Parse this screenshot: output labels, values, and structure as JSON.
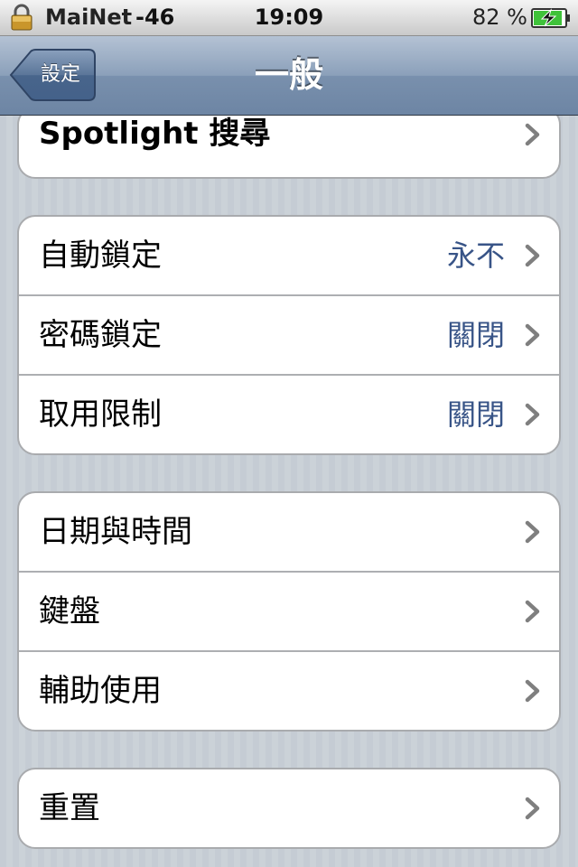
{
  "status_bar": {
    "carrier": "MaiNet",
    "signal": "-46",
    "time": "19:09",
    "battery_percent": "82 %",
    "icons": [
      "lock-icon",
      "battery-charging-icon"
    ]
  },
  "nav_bar": {
    "back_label": "設定",
    "title": "一般"
  },
  "groups": [
    {
      "rows": [
        {
          "label": "Spotlight 搜尋",
          "value": ""
        }
      ]
    },
    {
      "rows": [
        {
          "label": "自動鎖定",
          "value": "永不"
        },
        {
          "label": "密碼鎖定",
          "value": "關閉"
        },
        {
          "label": "取用限制",
          "value": "關閉"
        }
      ]
    },
    {
      "rows": [
        {
          "label": "日期與時間",
          "value": ""
        },
        {
          "label": "鍵盤",
          "value": ""
        },
        {
          "label": "輔助使用",
          "value": ""
        }
      ]
    },
    {
      "rows": [
        {
          "label": "重置",
          "value": ""
        }
      ]
    }
  ],
  "colors": {
    "value_text": "#385487",
    "nav_bar": "#6d85a4",
    "background": "#c5ccd4"
  }
}
